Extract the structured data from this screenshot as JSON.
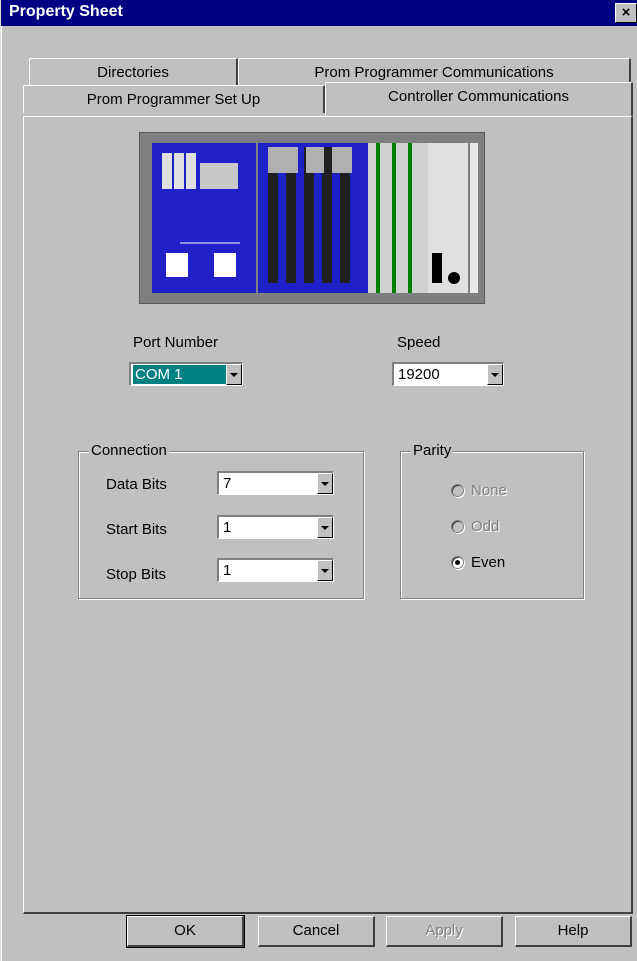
{
  "window": {
    "title": "Property Sheet",
    "close_glyph": "×"
  },
  "tabs": [
    {
      "label": "Directories"
    },
    {
      "label": "Prom Programmer Communications"
    },
    {
      "label": "Prom Programmer Set Up"
    },
    {
      "label": "Controller Communications"
    }
  ],
  "active_tab": "Controller Communications",
  "port": {
    "label": "Port Number",
    "value": "COM 1"
  },
  "speed": {
    "label": "Speed",
    "value": "19200"
  },
  "connection": {
    "legend": "Connection",
    "data_bits": {
      "label": "Data Bits",
      "value": "7"
    },
    "start_bits": {
      "label": "Start Bits",
      "value": "1"
    },
    "stop_bits": {
      "label": "Stop Bits",
      "value": "1"
    }
  },
  "parity": {
    "legend": "Parity",
    "options": [
      {
        "label": "None",
        "checked": false,
        "enabled": false
      },
      {
        "label": "Odd",
        "checked": false,
        "enabled": false
      },
      {
        "label": "Even",
        "checked": true,
        "enabled": true
      }
    ]
  },
  "buttons": {
    "ok": "OK",
    "cancel": "Cancel",
    "apply": "Apply",
    "help": "Help"
  },
  "colors": {
    "titlebar": "#000080",
    "face": "#c0c0c0",
    "selection": "#008080",
    "device_blue": "#2020c8"
  },
  "icons": {
    "close": "close-icon",
    "dropdown": "chevron-down-icon",
    "device": "plc-rack-image"
  }
}
